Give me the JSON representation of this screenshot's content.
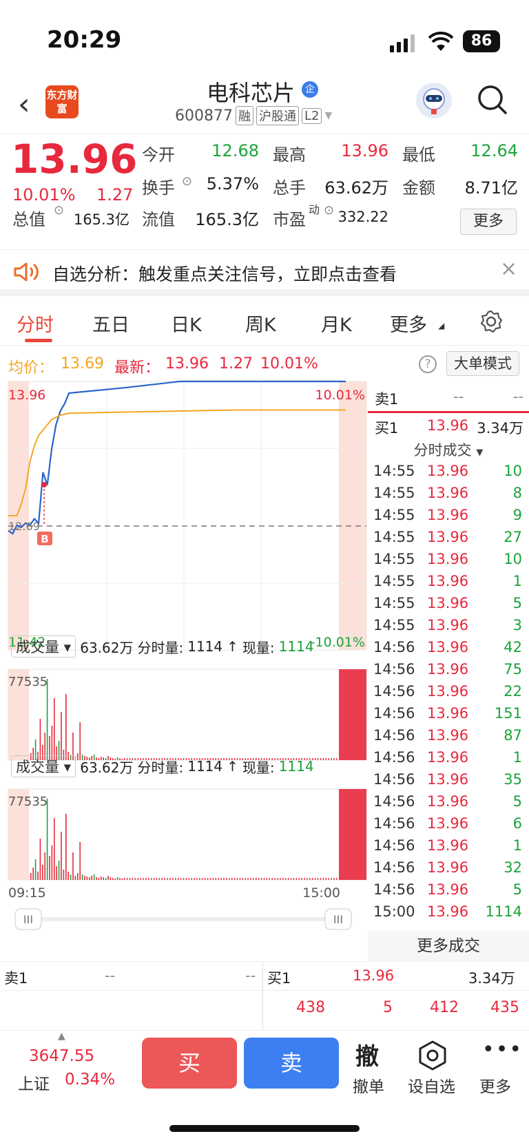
{
  "status_bar": {
    "time": "20:29",
    "battery": "86"
  },
  "header": {
    "logo_text": "东方财富",
    "stock_name": "电科芯片",
    "badge": "企",
    "code": "600877",
    "tags": [
      "融",
      "沪股通",
      "L2"
    ]
  },
  "quote": {
    "price": "13.96",
    "change_pct": "10.01%",
    "change": "1.27",
    "fields": [
      {
        "label": "今开",
        "value": "12.68",
        "color": "green"
      },
      {
        "label": "最高",
        "value": "13.96",
        "color": "red"
      },
      {
        "label": "最低",
        "value": "12.64",
        "color": "green"
      },
      {
        "label": "换手",
        "value": "5.37%",
        "color": "normal"
      },
      {
        "label": "总手",
        "value": "63.62万",
        "color": "normal"
      },
      {
        "label": "金额",
        "value": "8.71亿",
        "color": "normal"
      },
      {
        "label": "总值",
        "value": "165.3亿",
        "color": "normal"
      },
      {
        "label": "流值",
        "value": "165.3亿",
        "color": "normal"
      },
      {
        "label": "市盈",
        "value": "332.22",
        "color": "normal",
        "sup": "动"
      }
    ],
    "more_label": "更多"
  },
  "banner": {
    "text": "自选分析：触发重点关注信号，立即点击查看"
  },
  "tabs": [
    "分时",
    "五日",
    "日K",
    "周K",
    "月K",
    "更多"
  ],
  "avg_line": {
    "avg_label": "均价：",
    "avg_value": "13.69",
    "latest_label": "最新：",
    "latest_value": "13.96",
    "latest_change": "1.27",
    "latest_pct": "10.01%",
    "big_order_label": "大单模式"
  },
  "chart_data": {
    "type": "line",
    "title": "",
    "y_top_label": "13.96",
    "y_bottom_label": "11.42",
    "y_mid_label": "12.69",
    "pct_top_label": "10.01%",
    "pct_bottom_label": "-10.01%",
    "ylim": [
      11.42,
      13.96
    ],
    "prev_close": 12.69,
    "marker": "B",
    "x_labels": [
      "09:15",
      "15:00"
    ],
    "series": [
      {
        "values": [
          12.55,
          12.52,
          12.6,
          12.58,
          12.62,
          12.6,
          12.66,
          12.62,
          13.1,
          12.98,
          13.32,
          13.55,
          13.68,
          13.75,
          13.85,
          13.9,
          13.96,
          13.96,
          13.96,
          13.96
        ]
      },
      {
        "values": [
          12.69,
          12.69,
          12.69,
          12.8,
          12.95,
          13.2,
          13.35,
          13.45,
          13.5,
          13.55,
          13.6,
          13.62,
          13.64,
          13.65,
          13.66,
          13.67,
          13.68,
          13.69,
          13.69,
          13.69
        ]
      }
    ]
  },
  "volume": {
    "selector": "成交量",
    "total": "63.62万",
    "fenshi_label": "分时量:",
    "fenshi_value": "1114",
    "arrow": "↑",
    "now_label": "现量:",
    "now_value": "1114",
    "max_label": "77535"
  },
  "order_book_side": {
    "sell1_label": "卖1",
    "sell1_price": "--",
    "sell1_vol": "--",
    "buy1_label": "买1",
    "buy1_price": "13.96",
    "buy1_vol": "3.34万",
    "ticks_header": "分时成交"
  },
  "ticks": [
    {
      "t": "14:55",
      "p": "13.96",
      "v": "10"
    },
    {
      "t": "14:55",
      "p": "13.96",
      "v": "8"
    },
    {
      "t": "14:55",
      "p": "13.96",
      "v": "9"
    },
    {
      "t": "14:55",
      "p": "13.96",
      "v": "27"
    },
    {
      "t": "14:55",
      "p": "13.96",
      "v": "10"
    },
    {
      "t": "14:55",
      "p": "13.96",
      "v": "1"
    },
    {
      "t": "14:55",
      "p": "13.96",
      "v": "5"
    },
    {
      "t": "14:55",
      "p": "13.96",
      "v": "3"
    },
    {
      "t": "14:56",
      "p": "13.96",
      "v": "42"
    },
    {
      "t": "14:56",
      "p": "13.96",
      "v": "75"
    },
    {
      "t": "14:56",
      "p": "13.96",
      "v": "22"
    },
    {
      "t": "14:56",
      "p": "13.96",
      "v": "151"
    },
    {
      "t": "14:56",
      "p": "13.96",
      "v": "87"
    },
    {
      "t": "14:56",
      "p": "13.96",
      "v": "1"
    },
    {
      "t": "14:56",
      "p": "13.96",
      "v": "35"
    },
    {
      "t": "14:56",
      "p": "13.96",
      "v": "5"
    },
    {
      "t": "14:56",
      "p": "13.96",
      "v": "6"
    },
    {
      "t": "14:56",
      "p": "13.96",
      "v": "1"
    },
    {
      "t": "14:56",
      "p": "13.96",
      "v": "32"
    },
    {
      "t": "14:56",
      "p": "13.96",
      "v": "5"
    },
    {
      "t": "15:00",
      "p": "13.96",
      "v": "1114"
    }
  ],
  "more_trades": "更多成交",
  "bottom_book": {
    "sell1_label": "卖1",
    "sell1_price": "--",
    "sell1_vol": "--",
    "buy1_label": "买1",
    "buy1_price": "13.96",
    "buy1_vol": "3.34万",
    "row2": [
      "438",
      "5",
      "412",
      "435"
    ]
  },
  "toolbar": {
    "index_value": "3647.55",
    "index_name": "上证",
    "index_pct": "0.34%",
    "buy": "买",
    "sell": "卖",
    "cancel_glyph": "撤",
    "cancel": "撤单",
    "watch": "设自选",
    "more": "更多"
  }
}
